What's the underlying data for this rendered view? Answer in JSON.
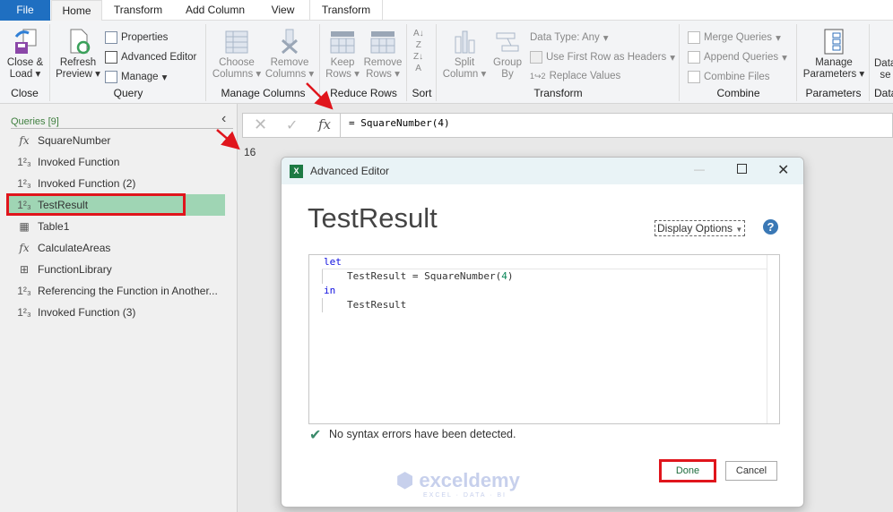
{
  "tabs": [
    "File",
    "Home",
    "Transform",
    "Add Column",
    "View",
    "Transform"
  ],
  "ribbon": {
    "close_load": "Close &",
    "close_load2": "Load",
    "close_group": "Close",
    "refresh": "Refresh",
    "refresh2": "Preview",
    "properties": "Properties",
    "advanced_editor": "Advanced Editor",
    "manage": "Manage",
    "query_group": "Query",
    "choose": "Choose",
    "choose2": "Columns",
    "remove": "Remove",
    "remove2": "Columns",
    "manage_columns_group": "Manage Columns",
    "keep": "Keep",
    "keep2": "Rows",
    "remove_rows": "Remove",
    "remove_rows2": "Rows",
    "reduce_rows_group": "Reduce Rows",
    "sort_group": "Sort",
    "split": "Split",
    "split2": "Column",
    "group": "Group",
    "group2": "By",
    "data_type": "Data Type: Any",
    "first_row": "Use First Row as Headers",
    "replace": "Replace Values",
    "transform_group": "Transform",
    "merge": "Merge Queries",
    "append": "Append Queries",
    "combine_files": "Combine Files",
    "combine_group": "Combine",
    "manage_params": "Manage",
    "manage_params2": "Parameters",
    "parameters_group": "Parameters",
    "data_source": "Data",
    "data_source2": "se",
    "data_group": "Data"
  },
  "sidebar": {
    "header": "Queries [9]",
    "items": [
      {
        "icon": "fx",
        "label": "SquareNumber"
      },
      {
        "icon": "123",
        "label": "Invoked Function"
      },
      {
        "icon": "123",
        "label": "Invoked Function (2)"
      },
      {
        "icon": "123",
        "label": "TestResult"
      },
      {
        "icon": "table",
        "label": "Table1"
      },
      {
        "icon": "fx",
        "label": "CalculateAreas"
      },
      {
        "icon": "grid",
        "label": "FunctionLibrary"
      },
      {
        "icon": "123",
        "label": "Referencing the Function in Another..."
      },
      {
        "icon": "123",
        "label": "Invoked Function (3)"
      }
    ]
  },
  "formula": {
    "fx": "fx",
    "text": "= SquareNumber(4)"
  },
  "result": "16",
  "dialog": {
    "title": "Advanced Editor",
    "query_name": "TestResult",
    "display_options": "Display Options",
    "help": "?",
    "code": {
      "l1": "let",
      "l2a": "TestResult = SquareNumber(",
      "l2n": "4",
      "l2b": ")",
      "l3": "in",
      "l4": "TestResult"
    },
    "status": "No syntax errors have been detected.",
    "done": "Done",
    "cancel": "Cancel"
  },
  "watermark": {
    "name": "exceldemy",
    "tag": "EXCEL · DATA · BI"
  }
}
